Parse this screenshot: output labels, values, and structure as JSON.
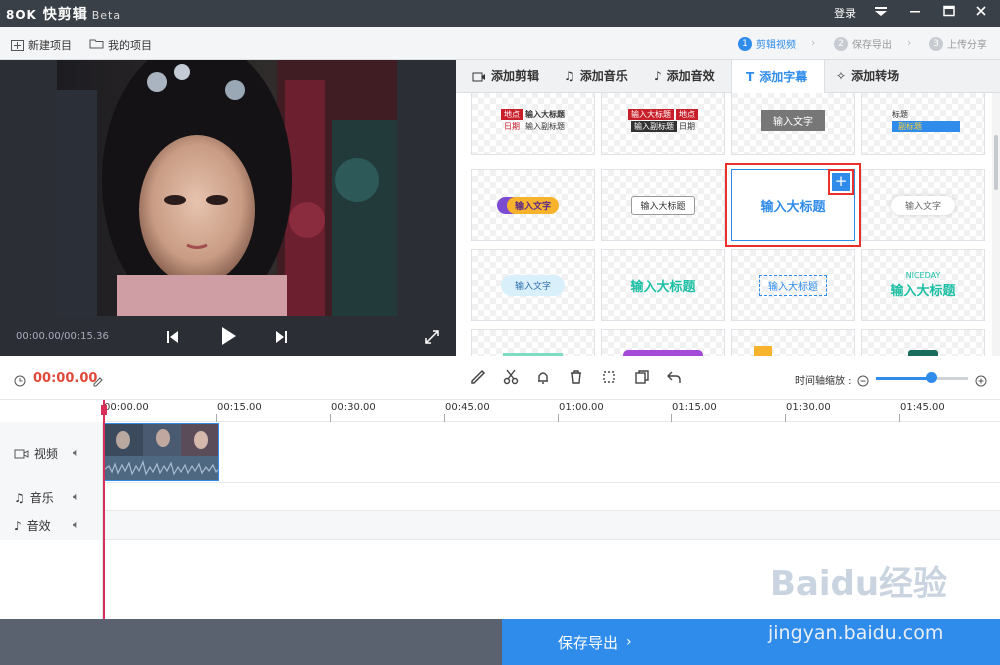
{
  "app": {
    "name": "快剪辑",
    "badge": "Beta",
    "login": "登录"
  },
  "toolbar": {
    "new_project": "新建项目",
    "my_projects": "我的项目"
  },
  "steps": [
    {
      "num": "1",
      "label": "剪辑视频"
    },
    {
      "num": "2",
      "label": "保存导出"
    },
    {
      "num": "3",
      "label": "上传分享"
    }
  ],
  "player": {
    "timecode": "00:00.00/00:15.36"
  },
  "tabs": [
    "添加剪辑",
    "添加音乐",
    "添加音效",
    "添加字幕",
    "添加转场"
  ],
  "subtitle_templates": {
    "r1c1": {
      "a": "地点",
      "b": "输入大标题",
      "c": "日期",
      "d": "输入副标题"
    },
    "r1c2": {
      "a": "输入大标题",
      "b": "地点",
      "c": "输入副标题",
      "d": "日期"
    },
    "r1c3": {
      "text": "输入文字"
    },
    "r1c4": {
      "a": "标题",
      "b": "副标题"
    },
    "r2c1": {
      "text": "输入文字"
    },
    "r2c2": {
      "text": "输入大标题"
    },
    "r2c3": {
      "text": "输入大标题",
      "add": "+"
    },
    "r2c4": {
      "text": "输入文字"
    },
    "r3c1": {
      "text": "输入文字"
    },
    "r3c2": {
      "text": "输入大标题"
    },
    "r3c3": {
      "text": "输入大标题"
    },
    "r3c4": {
      "a": "NICEDAY",
      "b": "输入大标题"
    }
  },
  "editor": {
    "play_time": "00:00.00",
    "zoom_label": "时间轴缩放 :"
  },
  "ruler": [
    "00:00.00",
    "00:15.00",
    "00:30.00",
    "00:45.00",
    "01:00.00",
    "01:15.00",
    "01:30.00",
    "01:45.00"
  ],
  "tracks": [
    {
      "label": "视频"
    },
    {
      "label": "音乐"
    },
    {
      "label": "音效"
    }
  ],
  "export": {
    "label": "保存导出"
  },
  "watermark": {
    "brand": "Baidu经验",
    "url": "jingyan.baidu.com"
  },
  "colors": {
    "accent": "#2f8cea",
    "playhead": "#d62f5a",
    "time": "#e04a3a",
    "highlight": "#e8312b"
  }
}
